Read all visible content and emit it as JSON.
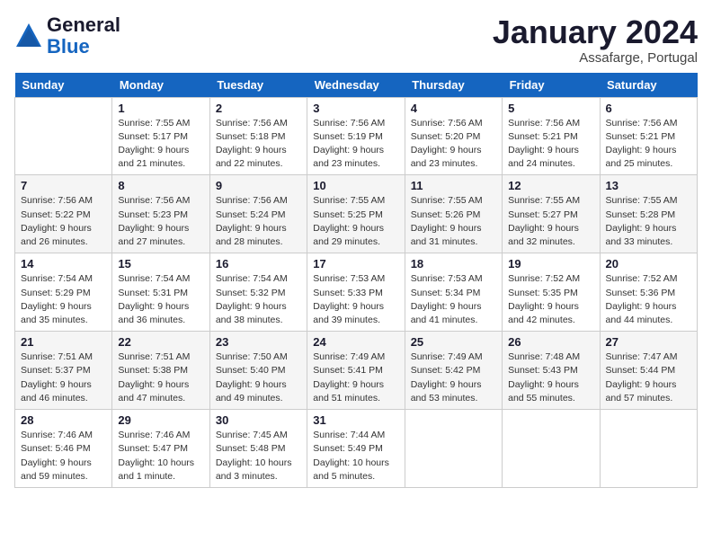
{
  "logo": {
    "line1": "General",
    "line2": "Blue"
  },
  "header": {
    "month": "January 2024",
    "location": "Assafarge, Portugal"
  },
  "weekdays": [
    "Sunday",
    "Monday",
    "Tuesday",
    "Wednesday",
    "Thursday",
    "Friday",
    "Saturday"
  ],
  "weeks": [
    [
      {
        "day": "",
        "info": ""
      },
      {
        "day": "1",
        "info": "Sunrise: 7:55 AM\nSunset: 5:17 PM\nDaylight: 9 hours\nand 21 minutes."
      },
      {
        "day": "2",
        "info": "Sunrise: 7:56 AM\nSunset: 5:18 PM\nDaylight: 9 hours\nand 22 minutes."
      },
      {
        "day": "3",
        "info": "Sunrise: 7:56 AM\nSunset: 5:19 PM\nDaylight: 9 hours\nand 23 minutes."
      },
      {
        "day": "4",
        "info": "Sunrise: 7:56 AM\nSunset: 5:20 PM\nDaylight: 9 hours\nand 23 minutes."
      },
      {
        "day": "5",
        "info": "Sunrise: 7:56 AM\nSunset: 5:21 PM\nDaylight: 9 hours\nand 24 minutes."
      },
      {
        "day": "6",
        "info": "Sunrise: 7:56 AM\nSunset: 5:21 PM\nDaylight: 9 hours\nand 25 minutes."
      }
    ],
    [
      {
        "day": "7",
        "info": "Sunrise: 7:56 AM\nSunset: 5:22 PM\nDaylight: 9 hours\nand 26 minutes."
      },
      {
        "day": "8",
        "info": "Sunrise: 7:56 AM\nSunset: 5:23 PM\nDaylight: 9 hours\nand 27 minutes."
      },
      {
        "day": "9",
        "info": "Sunrise: 7:56 AM\nSunset: 5:24 PM\nDaylight: 9 hours\nand 28 minutes."
      },
      {
        "day": "10",
        "info": "Sunrise: 7:55 AM\nSunset: 5:25 PM\nDaylight: 9 hours\nand 29 minutes."
      },
      {
        "day": "11",
        "info": "Sunrise: 7:55 AM\nSunset: 5:26 PM\nDaylight: 9 hours\nand 31 minutes."
      },
      {
        "day": "12",
        "info": "Sunrise: 7:55 AM\nSunset: 5:27 PM\nDaylight: 9 hours\nand 32 minutes."
      },
      {
        "day": "13",
        "info": "Sunrise: 7:55 AM\nSunset: 5:28 PM\nDaylight: 9 hours\nand 33 minutes."
      }
    ],
    [
      {
        "day": "14",
        "info": "Sunrise: 7:54 AM\nSunset: 5:29 PM\nDaylight: 9 hours\nand 35 minutes."
      },
      {
        "day": "15",
        "info": "Sunrise: 7:54 AM\nSunset: 5:31 PM\nDaylight: 9 hours\nand 36 minutes."
      },
      {
        "day": "16",
        "info": "Sunrise: 7:54 AM\nSunset: 5:32 PM\nDaylight: 9 hours\nand 38 minutes."
      },
      {
        "day": "17",
        "info": "Sunrise: 7:53 AM\nSunset: 5:33 PM\nDaylight: 9 hours\nand 39 minutes."
      },
      {
        "day": "18",
        "info": "Sunrise: 7:53 AM\nSunset: 5:34 PM\nDaylight: 9 hours\nand 41 minutes."
      },
      {
        "day": "19",
        "info": "Sunrise: 7:52 AM\nSunset: 5:35 PM\nDaylight: 9 hours\nand 42 minutes."
      },
      {
        "day": "20",
        "info": "Sunrise: 7:52 AM\nSunset: 5:36 PM\nDaylight: 9 hours\nand 44 minutes."
      }
    ],
    [
      {
        "day": "21",
        "info": "Sunrise: 7:51 AM\nSunset: 5:37 PM\nDaylight: 9 hours\nand 46 minutes."
      },
      {
        "day": "22",
        "info": "Sunrise: 7:51 AM\nSunset: 5:38 PM\nDaylight: 9 hours\nand 47 minutes."
      },
      {
        "day": "23",
        "info": "Sunrise: 7:50 AM\nSunset: 5:40 PM\nDaylight: 9 hours\nand 49 minutes."
      },
      {
        "day": "24",
        "info": "Sunrise: 7:49 AM\nSunset: 5:41 PM\nDaylight: 9 hours\nand 51 minutes."
      },
      {
        "day": "25",
        "info": "Sunrise: 7:49 AM\nSunset: 5:42 PM\nDaylight: 9 hours\nand 53 minutes."
      },
      {
        "day": "26",
        "info": "Sunrise: 7:48 AM\nSunset: 5:43 PM\nDaylight: 9 hours\nand 55 minutes."
      },
      {
        "day": "27",
        "info": "Sunrise: 7:47 AM\nSunset: 5:44 PM\nDaylight: 9 hours\nand 57 minutes."
      }
    ],
    [
      {
        "day": "28",
        "info": "Sunrise: 7:46 AM\nSunset: 5:46 PM\nDaylight: 9 hours\nand 59 minutes."
      },
      {
        "day": "29",
        "info": "Sunrise: 7:46 AM\nSunset: 5:47 PM\nDaylight: 10 hours\nand 1 minute."
      },
      {
        "day": "30",
        "info": "Sunrise: 7:45 AM\nSunset: 5:48 PM\nDaylight: 10 hours\nand 3 minutes."
      },
      {
        "day": "31",
        "info": "Sunrise: 7:44 AM\nSunset: 5:49 PM\nDaylight: 10 hours\nand 5 minutes."
      },
      {
        "day": "",
        "info": ""
      },
      {
        "day": "",
        "info": ""
      },
      {
        "day": "",
        "info": ""
      }
    ]
  ]
}
